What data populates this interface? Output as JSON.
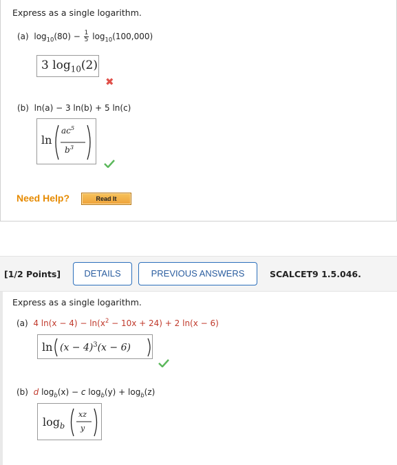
{
  "q1": {
    "prompt": "Express as a single logarithm.",
    "part_a": {
      "label": "(a)",
      "expr_left": "log",
      "expr_left_sub": "10",
      "expr_left_arg": "(80) −",
      "frac_num": "1",
      "frac_den": "5",
      "expr_right": "log",
      "expr_right_sub": "10",
      "expr_right_arg": "(100,000)",
      "answer_coef": "3 log",
      "answer_sub": "10",
      "answer_arg": "(2)",
      "status": "incorrect"
    },
    "part_b": {
      "label": "(b)",
      "expr": "ln(a) − 3 ln(b) + 5 ln(c)",
      "answer_fn": "ln",
      "answer_num": "ac",
      "answer_num_exp": "5",
      "answer_den": "b",
      "answer_den_exp": "3",
      "status": "correct"
    },
    "help_label": "Need Help?",
    "read_it_label": "Read It"
  },
  "header": {
    "points": "[1/2 Points]",
    "details_label": "DETAILS",
    "previous_answers_label": "PREVIOUS ANSWERS",
    "problem_code": "SCALCET9 1.5.046."
  },
  "q2": {
    "prompt": "Express as a single logarithm.",
    "part_a": {
      "label": "(a)",
      "expr_1": "4 ln(x − 4) − ln(x",
      "expr_sup": "2",
      "expr_2": " − 10x + 24) + 2 ln(x − 6)",
      "answer_fn": "ln",
      "answer_inner_1": "(x − 4)",
      "answer_exp": "3",
      "answer_inner_2": "(x − 6)",
      "status": "correct"
    },
    "part_b": {
      "label": "(b)",
      "d": "d",
      "log1": " log",
      "base": "b",
      "arg1": "(x) − ",
      "c": "c",
      "log2": " log",
      "arg2": "(y) + log",
      "arg3": "(z)",
      "answer_fn": "log",
      "answer_base": "b",
      "answer_num": "xz",
      "answer_den": "y"
    }
  },
  "colors": {
    "accent": "#2a6ebb",
    "red": "#c0392b",
    "help": "#e68a00",
    "check": "#5cb85c",
    "cross": "#e0504a"
  }
}
